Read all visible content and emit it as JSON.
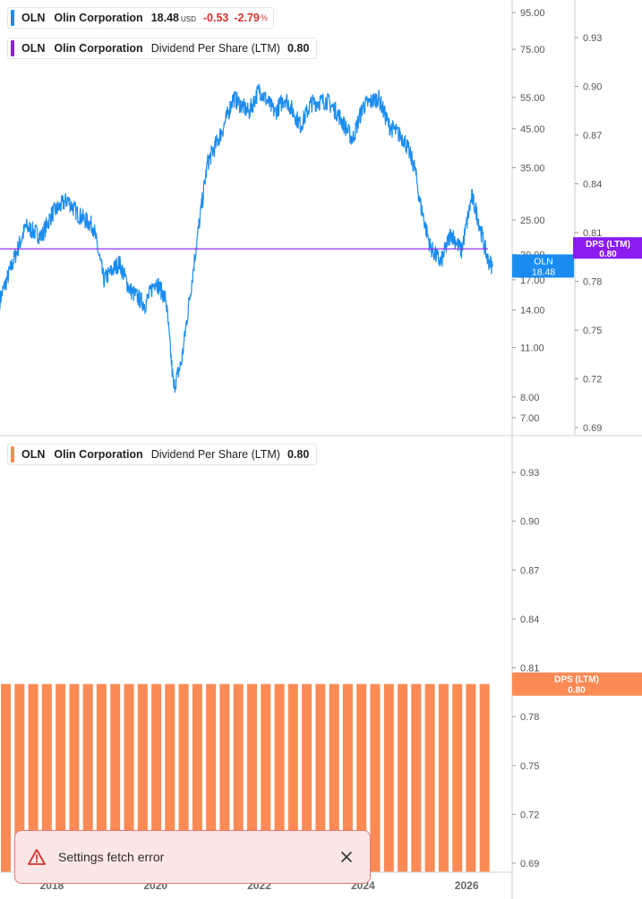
{
  "legend_price": {
    "ticker": "OLN",
    "company": "Olin Corporation",
    "price": "18.48",
    "currency": "USD",
    "change": "-0.53",
    "change_pct": "-2.79",
    "pct_sign": "%",
    "color": "#1a8cf0"
  },
  "legend_dps_top": {
    "ticker": "OLN",
    "company": "Olin Corporation",
    "metric": "Dividend Per Share (LTM)",
    "value": "0.80",
    "color": "#8a1cf0"
  },
  "legend_dps_bottom": {
    "ticker": "OLN",
    "company": "Olin Corporation",
    "metric": "Dividend Per Share (LTM)",
    "value": "0.80",
    "color": "#fb8a55"
  },
  "toast": {
    "message": "Settings fetch error",
    "icon": "warning-triangle-icon",
    "close_icon": "close-icon"
  },
  "chart_data": [
    {
      "type": "line",
      "scale": "log",
      "series": [
        {
          "x": [
            2017.0,
            2017.3,
            2017.5,
            2017.8,
            2018.0,
            2018.3,
            2018.5,
            2018.8,
            2019.0,
            2019.3,
            2019.5,
            2019.8,
            2020.0,
            2020.2,
            2020.35,
            2020.5,
            2020.8,
            2021.0,
            2021.3,
            2021.5,
            2021.8,
            2022.0,
            2022.3,
            2022.5,
            2022.8,
            2023.0,
            2023.3,
            2023.5,
            2023.8,
            2024.0,
            2024.3,
            2024.5,
            2024.8,
            2025.0,
            2025.1,
            2025.3,
            2025.5,
            2025.7,
            2025.9,
            2026.1,
            2026.2,
            2026.4,
            2026.5
          ],
          "y": [
            15.0,
            20.0,
            24.0,
            22.5,
            26.0,
            28.5,
            26.0,
            24.0,
            17.0,
            19.0,
            16.0,
            14.5,
            17.0,
            15.0,
            8.5,
            10.0,
            22.0,
            36.0,
            45.0,
            55.0,
            50.0,
            58.0,
            50.0,
            55.0,
            46.0,
            53.0,
            54.0,
            50.0,
            42.0,
            52.0,
            55.0,
            46.0,
            42.0,
            35.0,
            28.0,
            21.0,
            19.0,
            23.0,
            20.5,
            29.0,
            26.0,
            19.5,
            18.48
          ]
        }
      ],
      "last_label": {
        "name": "OLN",
        "value": "18.48",
        "color": "#1a8cf0"
      },
      "y_ticks": [
        "95.00",
        "75.00",
        "55.00",
        "45.00",
        "35.00",
        "25.00",
        "20.00",
        "17.00",
        "14.00",
        "11.00",
        "8.00",
        "7.00"
      ],
      "grid": false
    },
    {
      "type": "line",
      "series": [
        {
          "value": 0.8
        }
      ],
      "last_label": {
        "name": "DPS (LTM)",
        "value": "0.80",
        "color": "#8a1cf0"
      },
      "y_ticks": [
        "0.93",
        "0.90",
        "0.87",
        "0.84",
        "0.81",
        "0.78",
        "0.75",
        "0.72",
        "0.69"
      ],
      "grid": false
    },
    {
      "type": "bar",
      "categories": [
        "2017.75",
        "2018.00",
        "2018.25",
        "2018.50",
        "2018.75",
        "2019.00",
        "2019.25",
        "2019.50",
        "2019.75",
        "2020.00",
        "2020.25",
        "2020.50",
        "2020.75",
        "2021.00",
        "2021.25",
        "2021.50",
        "2021.75",
        "2022.00",
        "2022.25",
        "2022.50",
        "2022.75",
        "2023.00",
        "2023.25",
        "2023.50",
        "2023.75",
        "2024.00",
        "2024.25",
        "2024.50",
        "2024.75",
        "2025.00",
        "2025.25",
        "2025.50",
        "2025.75",
        "2026.00",
        "2026.25",
        "2026.50"
      ],
      "values": [
        0.8,
        0.8,
        0.8,
        0.8,
        0.8,
        0.8,
        0.8,
        0.8,
        0.8,
        0.8,
        0.8,
        0.8,
        0.8,
        0.8,
        0.8,
        0.8,
        0.8,
        0.8,
        0.8,
        0.8,
        0.8,
        0.8,
        0.8,
        0.8,
        0.8,
        0.8,
        0.8,
        0.8,
        0.8,
        0.8,
        0.8,
        0.8,
        0.8,
        0.8,
        0.8,
        0.8
      ],
      "last_label": {
        "name": "DPS (LTM)",
        "value": "0.80",
        "color": "#fb8a55"
      },
      "y_ticks": [
        "0.93",
        "0.90",
        "0.87",
        "0.84",
        "0.81",
        "0.78",
        "0.75",
        "0.72",
        "0.69"
      ],
      "x_ticks": [
        "2018",
        "2020",
        "2022",
        "2024",
        "2026"
      ],
      "ylim": [
        0.69,
        0.93
      ],
      "grid": false
    }
  ]
}
